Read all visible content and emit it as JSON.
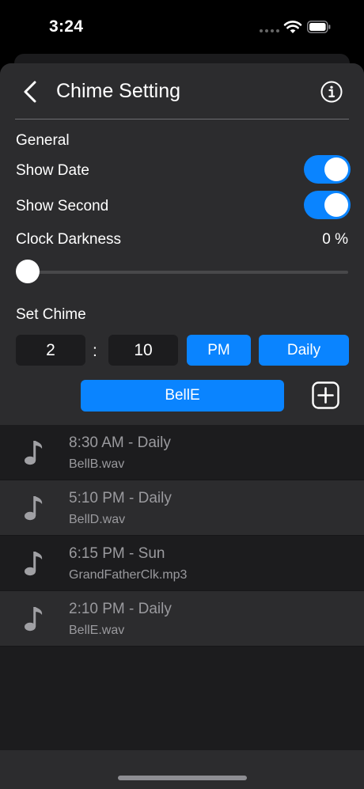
{
  "status_bar": {
    "time": "3:24"
  },
  "header": {
    "title": "Chime Setting"
  },
  "general": {
    "section_label": "General",
    "show_date": {
      "label": "Show Date",
      "on": true
    },
    "show_second": {
      "label": "Show Second",
      "on": true
    },
    "clock_darkness": {
      "label": "Clock Darkness",
      "value_text": "0 %",
      "value": 0
    }
  },
  "set_chime": {
    "section_label": "Set Chime",
    "hour": "2",
    "separator": ":",
    "minute": "10",
    "ampm": "PM",
    "repeat": "Daily",
    "sound": "BellE"
  },
  "chimes": [
    {
      "title": "8:30 AM - Daily",
      "file": "BellB.wav"
    },
    {
      "title": "5:10 PM - Daily",
      "file": "BellD.wav"
    },
    {
      "title": "6:15 PM - Sun",
      "file": "GrandFatherClk.mp3"
    },
    {
      "title": "2:10 PM - Daily",
      "file": "BellE.wav"
    }
  ],
  "colors": {
    "accent": "#0a84ff",
    "panel": "#2c2c2e",
    "background": "#1c1c1e"
  },
  "icons": {
    "back": "chevron-left-icon",
    "info": "info-circle-icon",
    "add": "plus-square-icon",
    "note": "music-note-icon"
  }
}
